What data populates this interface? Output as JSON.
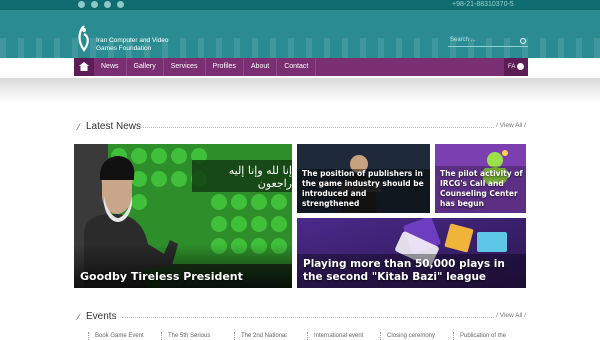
{
  "topbar": {
    "icons": [
      "home-icon",
      "info-icon",
      "mail-icon",
      "gear-icon"
    ],
    "phone": "+98-21-88310370-5"
  },
  "header": {
    "logo_text": "Iran Computer and Video Games Foundation",
    "search_placeholder": "Search ..."
  },
  "nav": {
    "items": [
      "News",
      "Gallery",
      "Services",
      "Profiles",
      "About",
      "Contact"
    ],
    "lang": "FA"
  },
  "latest_news": {
    "title": "Latest News",
    "view_all": "/ View All /",
    "items": [
      {
        "caption": "Goodby Tireless President",
        "banner_text": "إنا لله وإنا إليه راجعون"
      },
      {
        "caption": "The position of publishers in the game industry should be introduced and strengthened"
      },
      {
        "caption": "The pilot activity of IRCG's Call and Counseling Center has begun"
      },
      {
        "caption": "Playing more than 50,000 plays in the second \"Kitab Bazi\" league"
      }
    ]
  },
  "events": {
    "title": "Events",
    "view_all": "/ View All /",
    "items": [
      "Book Game Event",
      "The 5th Serious",
      "The 2nd National",
      "International event",
      "Closing ceremony",
      "Publication of the"
    ]
  },
  "colors": {
    "header_teal": "#2a8c92",
    "nav_purple": "#7a2f73",
    "accent": "#8b3b84"
  }
}
